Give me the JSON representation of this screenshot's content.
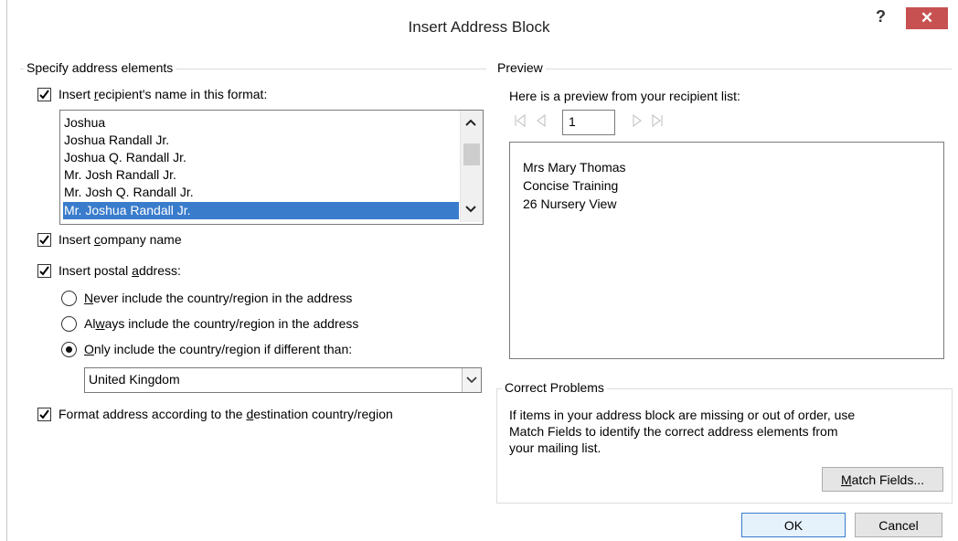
{
  "window": {
    "title": "Insert Address Block",
    "help_label": "?",
    "close_label": "✕"
  },
  "specify": {
    "legend": "Specify address elements",
    "recipient_name": {
      "label_pre": "Insert ",
      "label_ul": "r",
      "label_post": "ecipient's name in this format:",
      "checked": true
    },
    "name_formats": [
      "Joshua",
      "Joshua Randall Jr.",
      "Joshua Q. Randall Jr.",
      "Mr. Josh Randall Jr.",
      "Mr. Josh Q. Randall Jr.",
      "Mr. Joshua Randall Jr."
    ],
    "selected_format": "Mr. Joshua Randall Jr.",
    "company": {
      "label_pre": "Insert ",
      "label_ul": "c",
      "label_post": "ompany name",
      "checked": true
    },
    "postal": {
      "label_pre": "Insert postal ",
      "label_ul": "a",
      "label_post": "ddress:",
      "checked": true
    },
    "country_options": {
      "never": {
        "ul": "N",
        "rest": "ever include the country/region in the address"
      },
      "always": {
        "pre": "Al",
        "ul": "w",
        "rest": "ays include the country/region in the address"
      },
      "only": {
        "ul": "O",
        "rest": "nly include the country/region if different than:"
      },
      "selected": "only"
    },
    "country_value": "United Kingdom",
    "format_address": {
      "label_pre": "Format address according to the ",
      "label_ul": "d",
      "label_post": "estination country/region",
      "checked": true
    }
  },
  "preview": {
    "legend": "Preview",
    "intro": "Here is a preview from your recipient list:",
    "record_number": "1",
    "address_lines": [
      "Mrs Mary Thomas",
      "Concise Training",
      "26 Nursery View"
    ]
  },
  "correct_problems": {
    "legend": "Correct Problems",
    "text_lines": [
      "If items in your address block are missing or out of order, use",
      "Match Fields to identify the correct address elements from",
      "your mailing list."
    ],
    "match_fields": {
      "ul": "M",
      "rest": "atch Fields..."
    }
  },
  "buttons": {
    "ok": "OK",
    "cancel": "Cancel"
  },
  "icons": {
    "first_record": "first-record-icon",
    "prev_record": "previous-record-icon",
    "next_record": "next-record-icon",
    "last_record": "last-record-icon",
    "scroll_up": "chevron-up-icon",
    "scroll_down": "chevron-down-icon",
    "dropdown": "chevron-down-icon",
    "checkmark": "checkmark-icon"
  },
  "colors": {
    "selection": "#3a7ccc",
    "close_button": "#c75050"
  }
}
